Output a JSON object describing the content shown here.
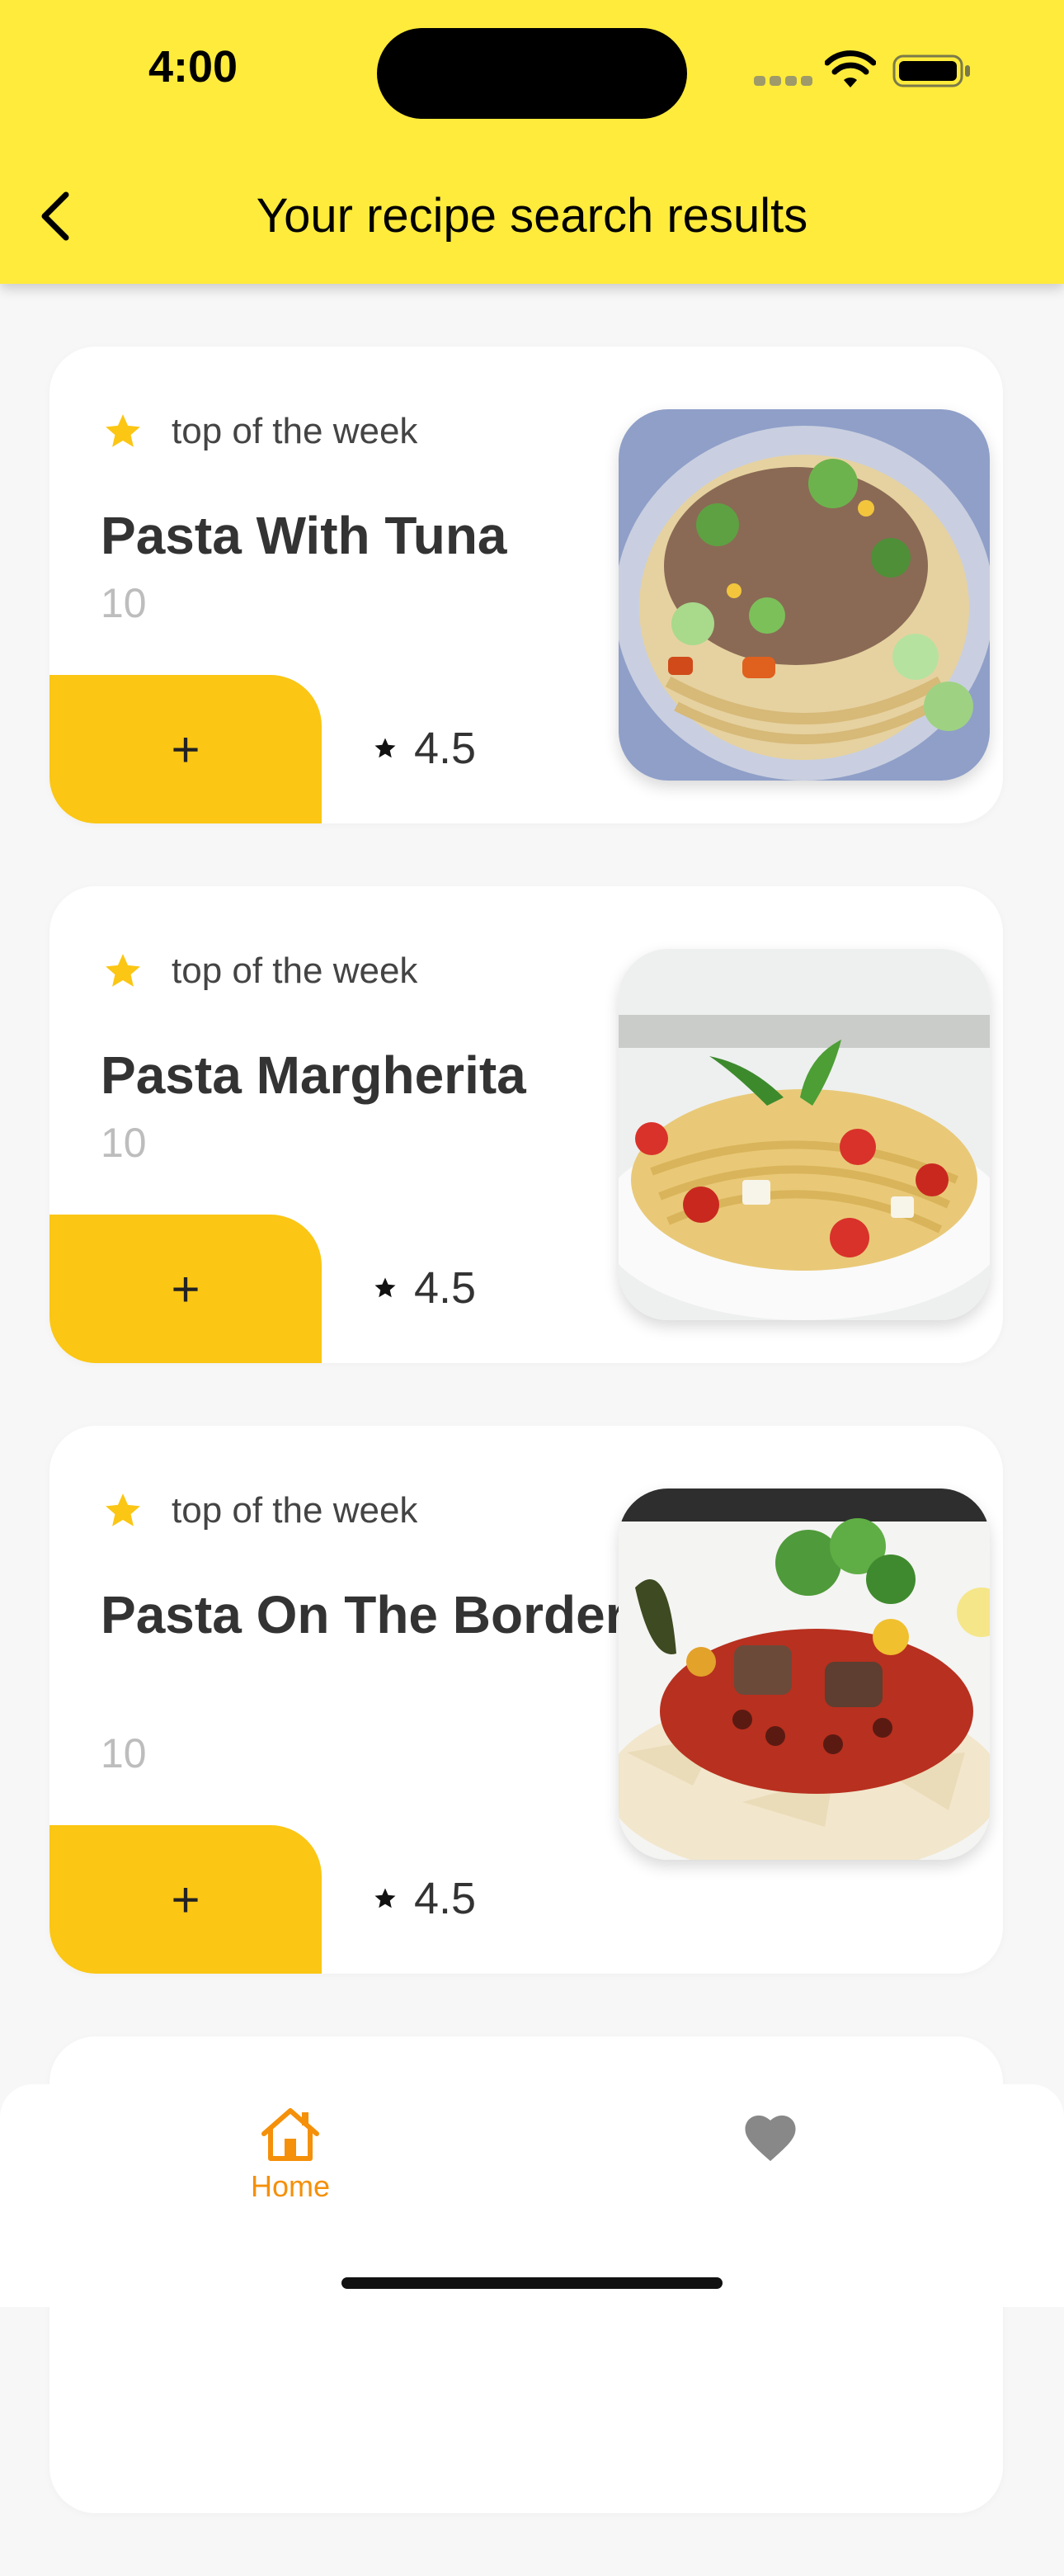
{
  "status_bar": {
    "time": "4:00"
  },
  "header": {
    "title": "Your recipe search results"
  },
  "recipes": [
    {
      "badge": "top of the week",
      "title": "Pasta With Tuna",
      "count": "10",
      "add_label": "+",
      "rating": "4.5"
    },
    {
      "badge": "top of the week",
      "title": "Pasta Margherita",
      "count": "10",
      "add_label": "+",
      "rating": "4.5"
    },
    {
      "badge": "top of the week",
      "title": "Pasta On The Border",
      "count": "10",
      "add_label": "+",
      "rating": "4.5"
    }
  ],
  "bottom_nav": {
    "home_label": "Home"
  },
  "colors": {
    "header": "#ffeb3b",
    "accent": "#fbc614",
    "active_tab": "#f5900a",
    "inactive_tab": "#888888"
  },
  "icons": [
    "back-chevron-icon",
    "star-icon",
    "home-icon",
    "heart-icon",
    "wifi-icon",
    "battery-icon"
  ]
}
